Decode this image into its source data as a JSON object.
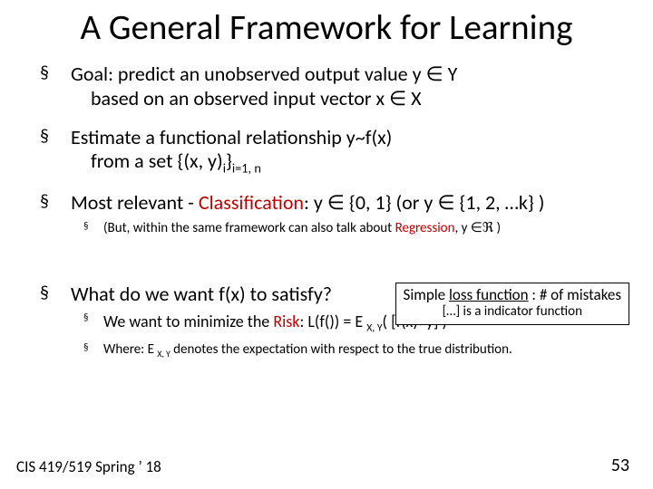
{
  "title": "A General Framework for Learning",
  "b1_a": "Goal: predict an unobserved output value y ",
  "b1_in1": "∈",
  "b1_b": " Y",
  "b1_c": "based on an observed input vector x ",
  "b1_in2": "∈",
  "b1_d": " X",
  "b2_a": "Estimate a functional relationship y~f(x)",
  "b2_b": "from a set  {(x, y)",
  "b2_sub1": "i",
  "b2_c": "}",
  "b2_sub2": "i=1, n",
  "b3_a": "Most relevant - ",
  "b3_red": "Classification",
  "b3_b": ": y ",
  "b3_in": "∈",
  "b3_c": " {0, 1} (or y ",
  "b3_in2": "∈",
  "b3_d": " {1, 2, …k} )",
  "b3s_a": "(But, within the same framework can also talk about ",
  "b3s_reg": "Regression",
  "b3s_b": ", y ",
  "b3s_in": "∈",
  "b3s_r": "ℜ",
  "b3s_c": " )",
  "call_a": "Simple ",
  "call_u": "loss function",
  "call_b": " : # of mistakes",
  "call_row2": "[…] is a indicator function",
  "b4": "What do we want f(x) to satisfy?",
  "b4s1_a": "We want to minimize the ",
  "b4s1_risk": "Risk",
  "b4s1_b": ":  L(f()) = E ",
  "b4s1_sub": "X, Y",
  "b4s1_c": "( [f(x)",
  "b4s1_ne": "≠",
  "b4s1_d": "y] )",
  "b4s2_a": "Where: E ",
  "b4s2_sub": "X, Y",
  "b4s2_b": " denotes the expectation with respect to the true distribution.",
  "footer_left": "CIS 419/519 Spring ’ 18",
  "footer_right": "53"
}
